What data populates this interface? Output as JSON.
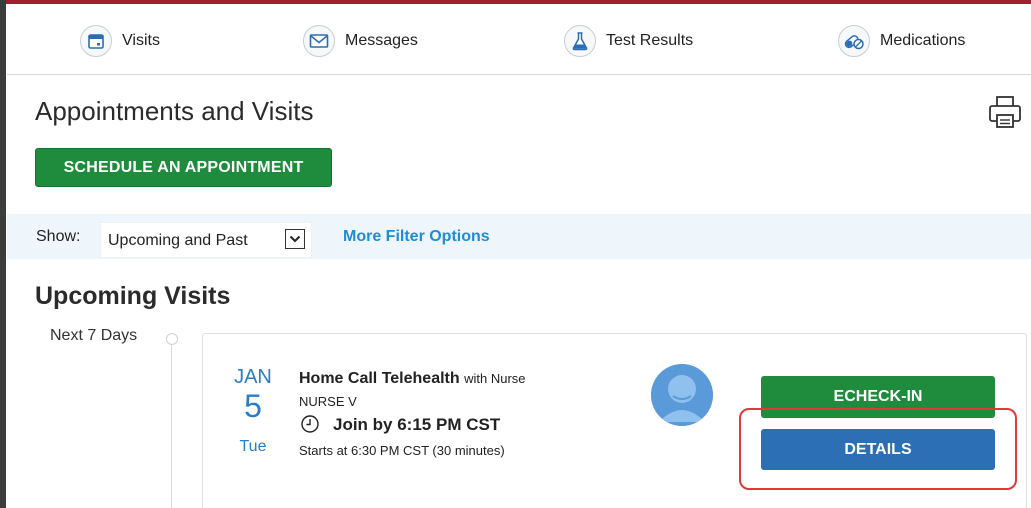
{
  "nav": {
    "items": [
      {
        "label": "Visits",
        "icon": "calendar-icon"
      },
      {
        "label": "Messages",
        "icon": "envelope-icon"
      },
      {
        "label": "Test Results",
        "icon": "flask-icon"
      },
      {
        "label": "Medications",
        "icon": "pills-icon"
      }
    ]
  },
  "page": {
    "title": "Appointments and Visits",
    "print_icon": "printer-icon",
    "schedule_label": "SCHEDULE AN APPOINTMENT"
  },
  "filter": {
    "show_label": "Show:",
    "selected": "Upcoming and Past",
    "more_label": "More Filter Options"
  },
  "upcoming": {
    "title": "Upcoming Visits",
    "group_label": "Next 7 Days",
    "visit": {
      "month": "JAN",
      "day": "5",
      "weekday": "Tue",
      "type": "Home Call Telehealth",
      "with_text": "with Nurse",
      "provider": "NURSE V",
      "join_text": "Join by 6:15 PM CST",
      "starts_text": "Starts at 6:30 PM CST (30 minutes)",
      "echeckin_label": "ECHECK-IN",
      "details_label": "DETAILS"
    }
  },
  "colors": {
    "accent_red": "#a0202e",
    "primary_green": "#1e8c3c",
    "primary_blue": "#2c6fb5",
    "link_blue": "#1f8dd6",
    "date_blue": "#2a7dc9",
    "highlight_red": "#e0383b"
  }
}
